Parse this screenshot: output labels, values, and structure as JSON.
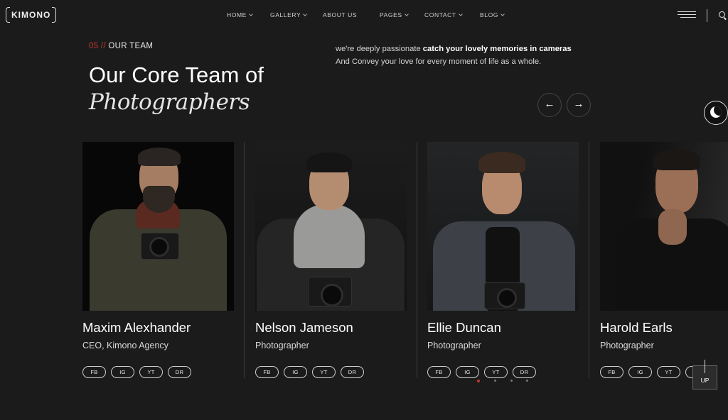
{
  "brand": {
    "logo_text": "KIMONO"
  },
  "nav": {
    "items": [
      {
        "label": "HOME",
        "has_dropdown": true
      },
      {
        "label": "GALLERY",
        "has_dropdown": true
      },
      {
        "label": "ABOUT US",
        "has_dropdown": false
      },
      {
        "label": "PAGES",
        "has_dropdown": true
      },
      {
        "label": "CONTACT",
        "has_dropdown": true
      },
      {
        "label": "BLOG",
        "has_dropdown": true
      }
    ]
  },
  "section": {
    "number": "05 //",
    "eyebrow": "OUR TEAM",
    "title_line1": "Our Core Team of",
    "title_line2": "Photographers",
    "intro_start": "we're deeply passionate ",
    "intro_bold": "catch your lovely memories in cameras",
    "intro_end": "And Convey your love for every moment of life as a whole."
  },
  "controls": {
    "prev_arrow": "←",
    "next_arrow": "→",
    "up_label": "UP"
  },
  "team": [
    {
      "name": "Maxim Alexhander",
      "role": "CEO, Kimono Agency"
    },
    {
      "name": "Nelson Jameson",
      "role": "Photographer"
    },
    {
      "name": "Ellie Duncan",
      "role": "Photographer"
    },
    {
      "name": "Harold Earls",
      "role": "Photographer"
    }
  ],
  "socials": [
    "FB",
    "IG",
    "YT",
    "DR"
  ],
  "pagination": {
    "active_index": 0,
    "count": 4
  },
  "colors": {
    "background": "#1b1b1c",
    "accent": "#c0392b",
    "text": "#ffffff"
  }
}
